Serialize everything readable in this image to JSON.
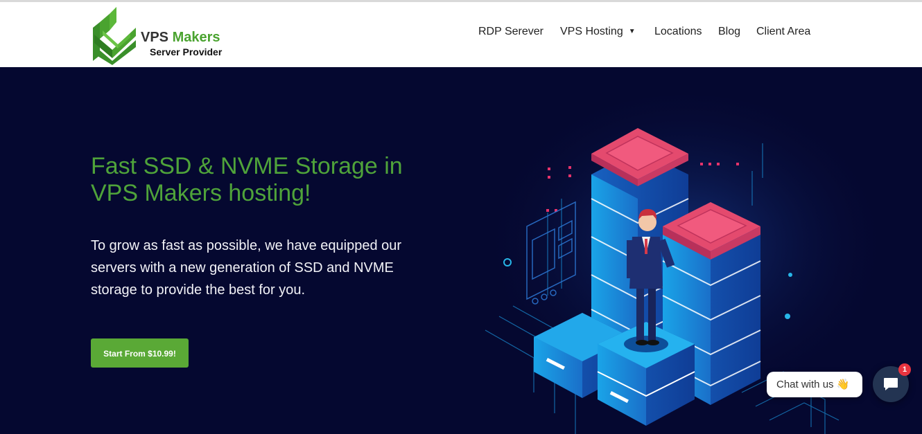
{
  "brand": {
    "name_part1": "VPS",
    "name_part2": "Makers",
    "tagline": "Server Provider",
    "logo_icon": "leaf-chevron-logo",
    "color_green": "#4aa32f"
  },
  "nav": {
    "items": [
      {
        "label": "RDP Serever"
      },
      {
        "label": "VPS Hosting",
        "has_dropdown": true
      },
      {
        "label": "Locations"
      },
      {
        "label": "Blog"
      },
      {
        "label": "Client Area"
      }
    ],
    "dropdown_icon": "caret-down-icon"
  },
  "hero": {
    "title_line1": "Fast SSD & NVME Storage in",
    "title_line2": "VPS Makers hosting!",
    "description": "To grow as fast as possible, we have equipped our servers with a new generation of SSD and NVME storage to provide the best for you.",
    "cta_label": "Start From $10.99!",
    "background_color": "#050830",
    "title_color": "#4fa33a",
    "cta_color": "#5aa936",
    "illustration": "isometric-server-stacks-businessman"
  },
  "chat": {
    "bubble_text": "Chat with us",
    "bubble_emoji": "👋",
    "launcher_icon": "chat-icon",
    "badge_count": "1",
    "badge_color": "#e8343f"
  }
}
